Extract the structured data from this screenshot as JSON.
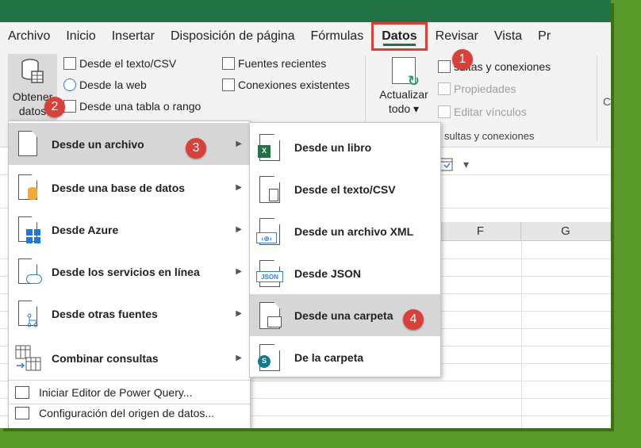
{
  "menu_tabs": [
    "Archivo",
    "Inicio",
    "Insertar",
    "Disposición de página",
    "Fórmulas",
    "Datos",
    "Revisar",
    "Vista",
    "Pr"
  ],
  "ribbon": {
    "get_data": {
      "line1": "Obtener",
      "line2": "datos"
    },
    "from_text_csv": "Desde el texto/CSV",
    "from_web": "Desde la web",
    "from_table": "Desde una tabla o rango",
    "recent_sources": "Fuentes recientes",
    "existing_connections": "Conexiones existentes",
    "refresh_all": {
      "line1": "Actualizar",
      "line2": "todo"
    },
    "queries_connections": "sultas y conexiones",
    "properties": "Propiedades",
    "edit_links": "Editar vínculos",
    "group_label": "sultas y conexiones",
    "partial_c": "C"
  },
  "columns": [
    "F",
    "G"
  ],
  "menu1": {
    "items": [
      {
        "label": "Desde un archivo"
      },
      {
        "label": "Desde una base de datos"
      },
      {
        "label": "Desde Azure"
      },
      {
        "label": "Desde los servicios en línea"
      },
      {
        "label": "Desde otras fuentes"
      },
      {
        "label": "Combinar consultas"
      }
    ],
    "launch_pq": "Iniciar Editor de Power Query...",
    "config": "Configuración del origen de datos..."
  },
  "menu2": {
    "items": [
      {
        "label": "Desde un libro"
      },
      {
        "label": "Desde el texto/CSV"
      },
      {
        "label": "Desde un archivo XML"
      },
      {
        "label": "Desde JSON"
      },
      {
        "label": "Desde una carpeta"
      },
      {
        "label": "De la carpeta"
      }
    ]
  },
  "badges": [
    "1",
    "2",
    "3",
    "4"
  ],
  "colors": {
    "excel_green": "#217346",
    "badge_red": "#d9403a",
    "frame_green": "#5a9a2a"
  }
}
